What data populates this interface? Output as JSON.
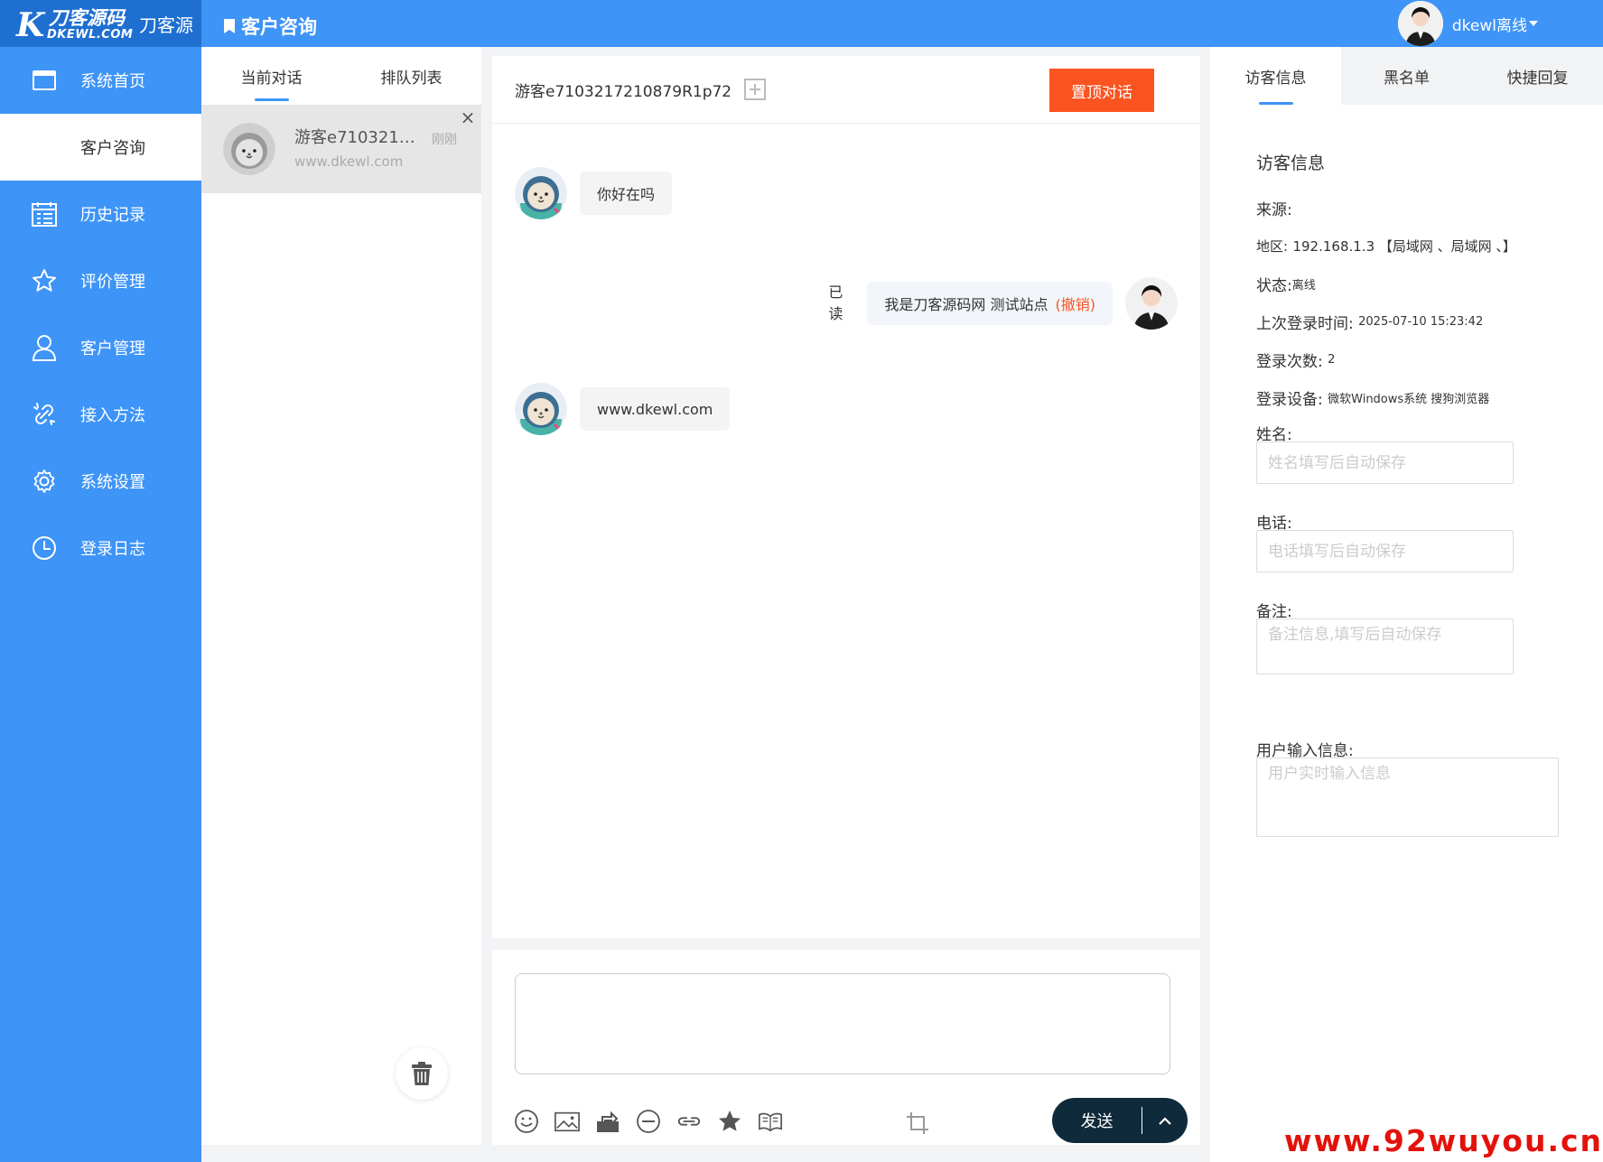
{
  "brand": {
    "logo_text": "刀客源码",
    "logo_sub": "DKEWL.COM",
    "name": "刀客源",
    "colors": {
      "primary": "#3e94f7",
      "accent": "#fb5420"
    }
  },
  "header": {
    "page_title": "客户咨询",
    "user_label": "dkewl离线"
  },
  "sidebar": {
    "items": [
      {
        "label": "系统首页",
        "icon": "home-window-icon"
      },
      {
        "label": "客户咨询",
        "icon": "chat-icon"
      },
      {
        "label": "历史记录",
        "icon": "calendar-list-icon"
      },
      {
        "label": "评价管理",
        "icon": "star-icon"
      },
      {
        "label": "客户管理",
        "icon": "user-icon"
      },
      {
        "label": "接入方法",
        "icon": "link-icon"
      },
      {
        "label": "系统设置",
        "icon": "gear-icon"
      },
      {
        "label": "登录日志",
        "icon": "clock-icon"
      }
    ]
  },
  "conversations": {
    "tabs": [
      "当前对话",
      "排队列表"
    ],
    "items": [
      {
        "name": "游客e710321…",
        "site": "www.dkewl.com",
        "time": "刚刚"
      }
    ]
  },
  "chat": {
    "visitor": "游客e7103217210879R1p72",
    "pin_label": "置顶对话",
    "messages": [
      {
        "from": "visitor",
        "text": "你好在吗"
      },
      {
        "from": "agent",
        "text": "我是刀客源码网 测试站点",
        "revoke": "(撤销)",
        "read": "已读",
        "read_top": "已",
        "read_bottom": "读"
      },
      {
        "from": "visitor",
        "text": "www.dkewl.com"
      }
    ],
    "send_label": "发送"
  },
  "info": {
    "tabs": [
      "访客信息",
      "黑名单",
      "快捷回复"
    ],
    "heading": "访客信息",
    "source_label": "来源:",
    "region_label": "地区:",
    "region_value": "192.168.1.3 【局域网 、局域网 、】",
    "status_label": "状态:",
    "status_value": "离线",
    "last_login_label": "上次登录时间:",
    "last_login_value": "2025-07-10 15:23:42",
    "login_count_label": "登录次数:",
    "login_count_value": "2",
    "device_label": "登录设备:",
    "device_value": "微软Windows系统 搜狗浏览器",
    "name_label": "姓名:",
    "name_placeholder": "姓名填写后自动保存",
    "phone_label": "电话:",
    "phone_placeholder": "电话填写后自动保存",
    "note_label": "备注:",
    "note_placeholder": "备注信息,填写后自动保存",
    "user_input_label": "用户输入信息:",
    "user_input_placeholder": "用户实时输入信息"
  },
  "watermark": "www.92wuyou.cn"
}
